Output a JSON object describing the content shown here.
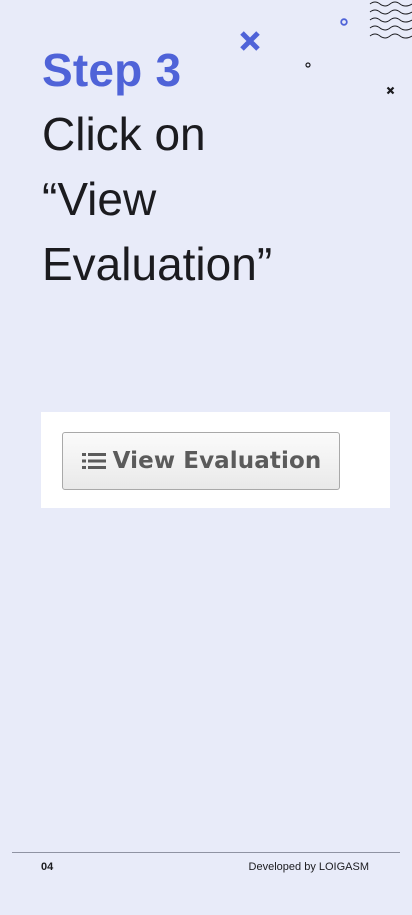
{
  "step": {
    "title": "Step 3",
    "instruction_lines": [
      "Click on",
      "“View",
      "Evaluation”"
    ]
  },
  "screenshot": {
    "button": {
      "icon": "list-icon",
      "label": "View Evaluation"
    }
  },
  "footer": {
    "page_number": "04",
    "credit": "Developed by LOIGASM"
  },
  "colors": {
    "background": "#e8ebf9",
    "accent": "#4f63d8",
    "text": "#1b1b1f"
  }
}
